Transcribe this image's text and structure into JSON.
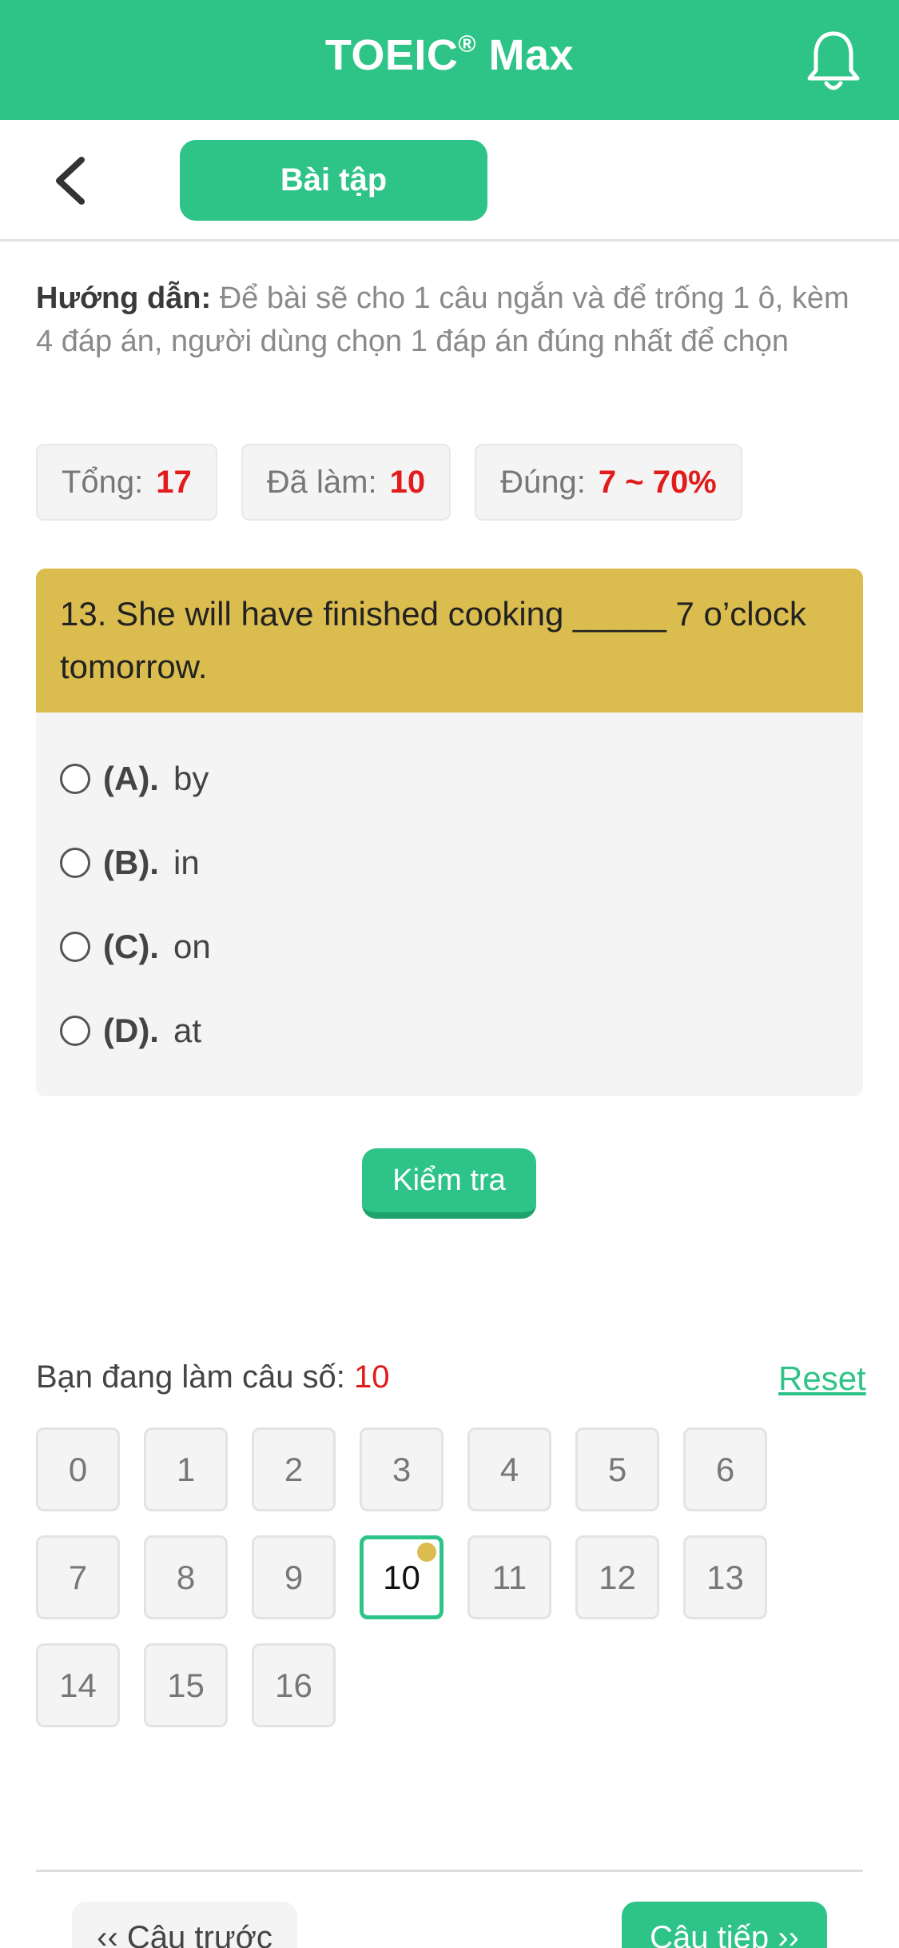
{
  "app": {
    "title": "TOEIC",
    "title_mark": "®",
    "title_suffix": " Max",
    "bell_icon": "bell-icon"
  },
  "subbar": {
    "back_icon": "chevron-left-icon",
    "tab_label": "Bài tập"
  },
  "guide": {
    "label": "Hướng dẫn:",
    "text": " Để bài sẽ cho 1 câu ngắn và để trống 1 ô, kèm 4 đáp án, người dùng chọn 1 đáp án đúng nhất để chọn"
  },
  "stats": [
    {
      "label": "Tổng:",
      "value": "17"
    },
    {
      "label": "Đã làm:",
      "value": "10"
    },
    {
      "label": "Đúng:",
      "value": "7 ~ 70%"
    }
  ],
  "question": {
    "text": "13. She will have finished cooking _____ 7 o’clock tomorrow.",
    "options": [
      {
        "label": "(A).",
        "text": "by"
      },
      {
        "label": "(B).",
        "text": "in"
      },
      {
        "label": "(C).",
        "text": "on"
      },
      {
        "label": "(D).",
        "text": "at"
      }
    ]
  },
  "check_button": "Kiểm tra",
  "progress": {
    "label": "Bạn đang làm câu số:",
    "current": "10",
    "reset": "Reset"
  },
  "question_numbers": [
    "0",
    "1",
    "2",
    "3",
    "4",
    "5",
    "6",
    "7",
    "8",
    "9",
    "10",
    "11",
    "12",
    "13",
    "14",
    "15",
    "16"
  ],
  "active_question": "10",
  "nav": {
    "prev": "‹‹ Câu trước",
    "next": "Câu tiếp ››"
  },
  "colors": {
    "primary": "#2ec488",
    "accent": "#dbbd4f",
    "highlight": "#e21b1b"
  }
}
